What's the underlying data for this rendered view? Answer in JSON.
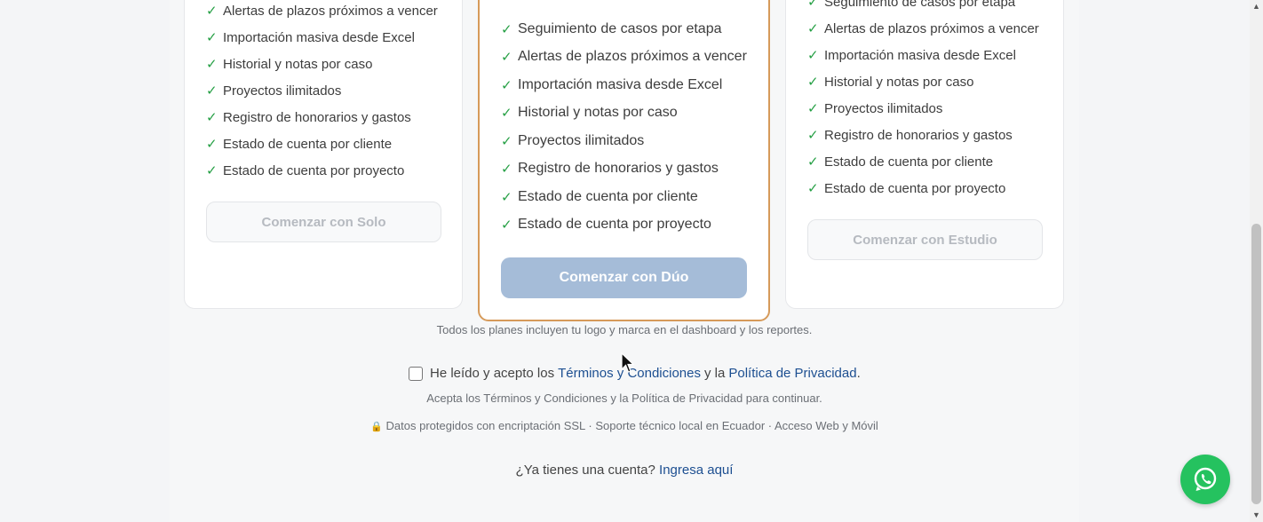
{
  "plans": {
    "solo": {
      "features": [
        "Alertas de plazos próximos a vencer",
        "Importación masiva desde Excel",
        "Historial y notas por caso",
        "Proyectos ilimitados",
        "Registro de honorarios y gastos",
        "Estado de cuenta por cliente",
        "Estado de cuenta por proyecto"
      ],
      "button": "Comenzar con Solo"
    },
    "duo": {
      "features": [
        "Seguimiento de casos por etapa",
        "Alertas de plazos próximos a vencer",
        "Importación masiva desde Excel",
        "Historial y notas por caso",
        "Proyectos ilimitados",
        "Registro de honorarios y gastos",
        "Estado de cuenta por cliente",
        "Estado de cuenta por proyecto"
      ],
      "button": "Comenzar con Dúo"
    },
    "estudio": {
      "features": [
        "Seguimiento de casos por etapa",
        "Alertas de plazos próximos a vencer",
        "Importación masiva desde Excel",
        "Historial y notas por caso",
        "Proyectos ilimitados",
        "Registro de honorarios y gastos",
        "Estado de cuenta por cliente",
        "Estado de cuenta por proyecto"
      ],
      "button": "Comenzar con Estudio"
    }
  },
  "check_glyph": "✓",
  "notes": {
    "branding": "Todos los planes incluyen tu logo y marca en el dashboard y los reportes.",
    "terms_prefix": "He leído y acepto los",
    "terms_link": "Términos y Condiciones",
    "terms_and": "y la",
    "privacy_link": "Política de Privacidad",
    "terms_period": ".",
    "terms_hint": "Acepta los Términos y Condiciones y la Política de Privacidad para continuar.",
    "security": "Datos protegidos con encriptación SSL · Soporte técnico local en Ecuador · Acceso Web y Móvil"
  },
  "login": {
    "question": "¿Ya tienes una cuenta?",
    "link": "Ingresa aquí"
  },
  "icons": {
    "check": "check-icon",
    "lock": "lock-icon",
    "whatsapp": "whatsapp-icon",
    "cursor": "cursor-icon"
  },
  "colors": {
    "check": "#26a045",
    "link": "#1d4f91",
    "featured_border": "#d69a5a",
    "primary_button": "#a5bcd8",
    "whatsapp": "#25c25f"
  }
}
